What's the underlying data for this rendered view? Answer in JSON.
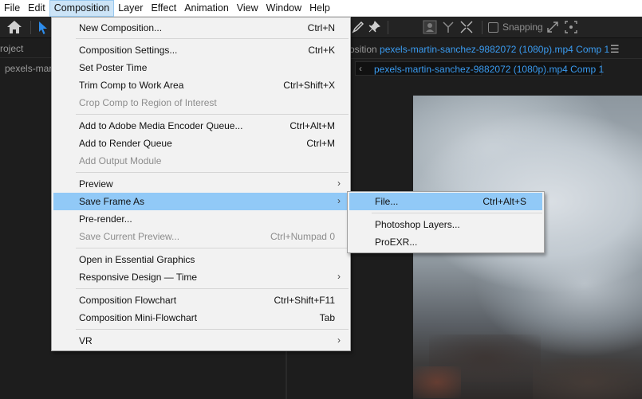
{
  "menubar": {
    "items": [
      "File",
      "Edit",
      "Composition",
      "Layer",
      "Effect",
      "Animation",
      "View",
      "Window",
      "Help"
    ],
    "active": "Composition"
  },
  "toolbar": {
    "home_icon": "home-icon",
    "selection_icon": "selection-arrow-icon",
    "snapping_label": "Snapping",
    "snapping_checked": false
  },
  "project_panel": {
    "tab_label": "roject",
    "item_label": "pexels-mart"
  },
  "composition_panel": {
    "tab_prefix": "osition",
    "tab_name": "pexels-martin-sanchez-9882072 (1080p).mp4 Comp 1",
    "breadcrumb": "pexels-martin-sanchez-9882072 (1080p).mp4 Comp 1",
    "accent_color": "#3a9bf0"
  },
  "composition_menu": {
    "items": [
      {
        "label": "New Composition...",
        "shortcut": "Ctrl+N"
      },
      {
        "label": "Composition Settings...",
        "shortcut": "Ctrl+K"
      },
      {
        "label": "Set Poster Time",
        "shortcut": ""
      },
      {
        "label": "Trim Comp to Work Area",
        "shortcut": "Ctrl+Shift+X"
      },
      {
        "label": "Crop Comp to Region of Interest",
        "shortcut": "",
        "disabled": true
      },
      {
        "label": "Add to Adobe Media Encoder Queue...",
        "shortcut": "Ctrl+Alt+M"
      },
      {
        "label": "Add to Render Queue",
        "shortcut": "Ctrl+M"
      },
      {
        "label": "Add Output Module",
        "shortcut": "",
        "disabled": true
      },
      {
        "label": "Preview",
        "shortcut": "",
        "submenu": true
      },
      {
        "label": "Save Frame As",
        "shortcut": "",
        "submenu": true,
        "highlighted": true
      },
      {
        "label": "Pre-render...",
        "shortcut": ""
      },
      {
        "label": "Save Current Preview...",
        "shortcut": "Ctrl+Numpad 0",
        "disabled": true
      },
      {
        "label": "Open in Essential Graphics",
        "shortcut": ""
      },
      {
        "label": "Responsive Design — Time",
        "shortcut": "",
        "submenu": true
      },
      {
        "label": "Composition Flowchart",
        "shortcut": "Ctrl+Shift+F11"
      },
      {
        "label": "Composition Mini-Flowchart",
        "shortcut": "Tab"
      },
      {
        "label": "VR",
        "shortcut": "",
        "submenu": true
      }
    ],
    "submenu_arrow": "›"
  },
  "save_frame_submenu": {
    "items": [
      {
        "label": "File...",
        "shortcut": "Ctrl+Alt+S",
        "highlighted": true
      },
      {
        "label": "Photoshop Layers...",
        "shortcut": ""
      },
      {
        "label": "ProEXR...",
        "shortcut": ""
      }
    ]
  },
  "colors": {
    "menu_highlight": "#91c9f7",
    "menubar_active": "#cce4f7",
    "app_background": "#1d1d1d"
  }
}
